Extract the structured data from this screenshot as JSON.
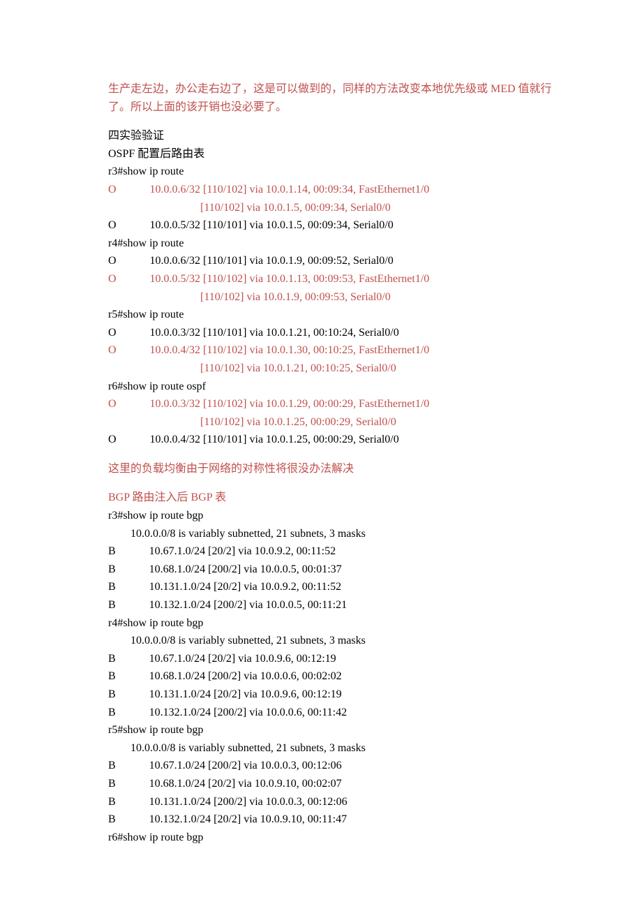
{
  "intro": {
    "p1": "生产走左边，办公走右边了，这是可以做到的，同样的方法改变本地优先级或 MED 值就行了。所以上面的该开销也没必要了。"
  },
  "section1": {
    "title": "四实验验证",
    "subtitle": "OSPF 配置后路由表",
    "r3_cmd": "r3#show ip route",
    "r3_l1": "O            10.0.0.6/32 [110/102] via 10.0.1.14, 00:09:34, FastEthernet1/0",
    "r3_l2": "                                 [110/102] via 10.0.1.5, 00:09:34, Serial0/0",
    "r3_l3": "O            10.0.0.5/32 [110/101] via 10.0.1.5, 00:09:34, Serial0/0",
    "r4_cmd": "r4#show ip route",
    "r4_l1": "O            10.0.0.6/32 [110/101] via 10.0.1.9, 00:09:52, Serial0/0",
    "r4_l2": "O            10.0.0.5/32 [110/102] via 10.0.1.13, 00:09:53, FastEthernet1/0",
    "r4_l3": "                                 [110/102] via 10.0.1.9, 00:09:53, Serial0/0",
    "r5_cmd": "r5#show ip route",
    "r5_l1": "O            10.0.0.3/32 [110/101] via 10.0.1.21, 00:10:24, Serial0/0",
    "r5_l2": "O            10.0.0.4/32 [110/102] via 10.0.1.30, 00:10:25, FastEthernet1/0",
    "r5_l3": "                                 [110/102] via 10.0.1.21, 00:10:25, Serial0/0",
    "r6_cmd": "r6#show ip route ospf",
    "r6_l1": "O            10.0.0.3/32 [110/102] via 10.0.1.29, 00:00:29, FastEthernet1/0",
    "r6_l2": "                                 [110/102] via 10.0.1.25, 00:00:29, Serial0/0",
    "r6_l3": "O            10.0.0.4/32 [110/101] via 10.0.1.25, 00:00:29, Serial0/0"
  },
  "note1": "这里的负载均衡由于网络的对称性将很没办法解决",
  "section2": {
    "title": "BGP 路由注入后 BGP 表",
    "r3_cmd": "r3#show ip route bgp",
    "r3_sub": "        10.0.0.0/8 is variably subnetted, 21 subnets, 3 masks",
    "r3_l1": "B            10.67.1.0/24 [20/2] via 10.0.9.2, 00:11:52",
    "r3_l2": "B            10.68.1.0/24 [200/2] via 10.0.0.5, 00:01:37",
    "r3_l3": "B            10.131.1.0/24 [20/2] via 10.0.9.2, 00:11:52",
    "r3_l4": "B            10.132.1.0/24 [200/2] via 10.0.0.5, 00:11:21",
    "r4_cmd": "r4#show ip route bgp",
    "r4_sub": "        10.0.0.0/8 is variably subnetted, 21 subnets, 3 masks",
    "r4_l1": "B            10.67.1.0/24 [20/2] via 10.0.9.6, 00:12:19",
    "r4_l2": "B            10.68.1.0/24 [200/2] via 10.0.0.6, 00:02:02",
    "r4_l3": "B            10.131.1.0/24 [20/2] via 10.0.9.6, 00:12:19",
    "r4_l4": "B            10.132.1.0/24 [200/2] via 10.0.0.6, 00:11:42",
    "r5_cmd": "r5#show ip route bgp",
    "r5_sub": "        10.0.0.0/8 is variably subnetted, 21 subnets, 3 masks",
    "r5_l1": "B            10.67.1.0/24 [200/2] via 10.0.0.3, 00:12:06",
    "r5_l2": "B            10.68.1.0/24 [20/2] via 10.0.9.10, 00:02:07",
    "r5_l3": "B            10.131.1.0/24 [200/2] via 10.0.0.3, 00:12:06",
    "r5_l4": "B            10.132.1.0/24 [20/2] via 10.0.9.10, 00:11:47",
    "r6_cmd": "r6#show ip route bgp"
  }
}
